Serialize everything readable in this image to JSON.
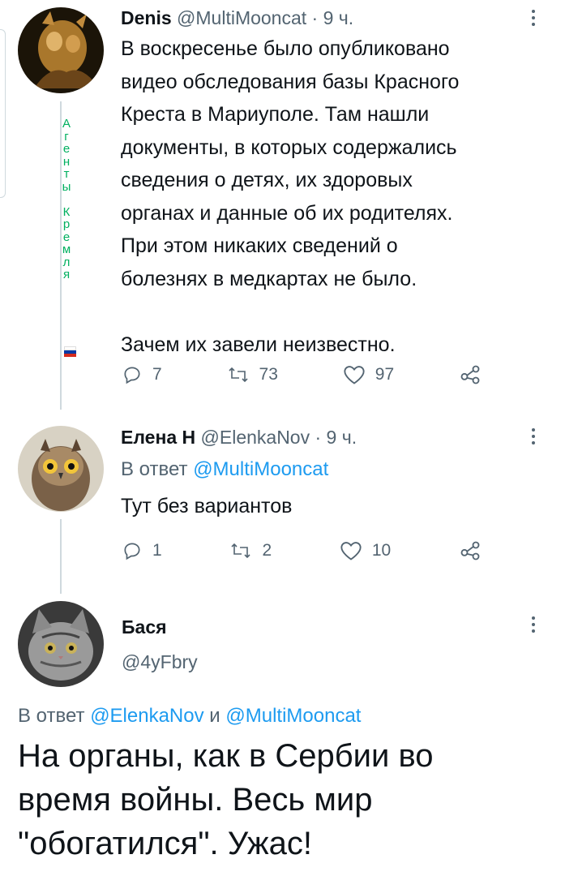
{
  "tweets": [
    {
      "name": "Denis",
      "handle": "@MultiMooncat",
      "time": "· 9 ч.",
      "text": "В воскресенье было опубликовано\nвидео обследования базы Красного\nКреста в Мариуполе. Там нашли\nдокументы, в которых содержались\nсведения о детях, их здоровых\nорганах и данные об их родителях.\nПри этом никаких сведений о\nболезнях в медкартах не было.\n\nЗачем их завели неизвестно.",
      "replies": "7",
      "retweets": "73",
      "likes": "97",
      "bio_letters": [
        "А",
        "г",
        "е",
        "н",
        "т",
        "ы",
        "",
        "К",
        "р",
        "е",
        "м",
        "л",
        "я"
      ]
    },
    {
      "name": "Елена Н",
      "handle": "@ElenkaNov",
      "time": "· 9 ч.",
      "reply_prefix": "В ответ",
      "reply_to": "@MultiMooncat",
      "text": "Тут без вариантов",
      "replies": "1",
      "retweets": "2",
      "likes": "10"
    },
    {
      "name": "Бася",
      "handle": "@4yFbry",
      "reply_prefix": "В ответ",
      "reply_to_1": "@ElenkaNov",
      "reply_and": "и",
      "reply_to_2": "@MultiMooncat",
      "text": "На органы, как в Сербии во\nвремя войны. Весь мир\n\"обогатился\". Ужас!"
    }
  ],
  "icons": [
    "reply-icon",
    "retweet-icon",
    "like-icon",
    "share-icon",
    "more-icon"
  ],
  "colors": {
    "link": "#1d9bf0",
    "muted": "#536471",
    "text": "#0f1419",
    "bio_green": "#00b060"
  }
}
